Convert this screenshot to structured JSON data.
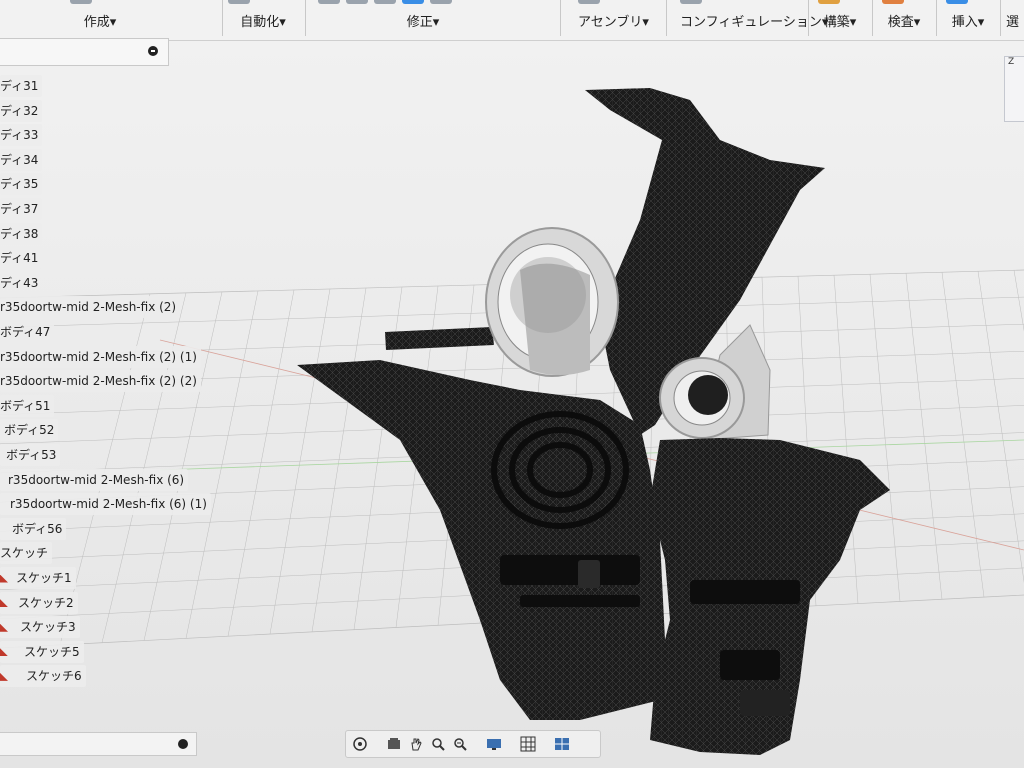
{
  "ribbon": {
    "groups": [
      {
        "id": "create",
        "label": "作成",
        "arrow": "▾"
      },
      {
        "id": "automate",
        "label": "自動化",
        "arrow": "▾"
      },
      {
        "id": "modify",
        "label": "修正",
        "arrow": "▾"
      },
      {
        "id": "assemble",
        "label": "アセンブリ",
        "arrow": "▾"
      },
      {
        "id": "configure",
        "label": "コンフィギュレーション",
        "arrow": "▾"
      },
      {
        "id": "construct",
        "label": "構築",
        "arrow": "▾"
      },
      {
        "id": "inspect",
        "label": "検査",
        "arrow": "▾"
      },
      {
        "id": "insert",
        "label": "挿入",
        "arrow": "▾"
      },
      {
        "id": "select",
        "label": "選"
      }
    ]
  },
  "browser": {
    "items": [
      {
        "label": "ディ31"
      },
      {
        "label": "ディ32"
      },
      {
        "label": "ディ33"
      },
      {
        "label": "ディ34"
      },
      {
        "label": "ディ35"
      },
      {
        "label": "ディ37"
      },
      {
        "label": "ディ38"
      },
      {
        "label": "ディ41"
      },
      {
        "label": "ディ43"
      },
      {
        "label": "r35doortw-mid 2-Mesh-fix (2)"
      },
      {
        "label": "ボディ47"
      },
      {
        "label": "r35doortw-mid 2-Mesh-fix (2) (1)"
      },
      {
        "label": "r35doortw-mid 2-Mesh-fix (2) (2)"
      },
      {
        "label": "ボディ51"
      },
      {
        "label": "ボディ52"
      },
      {
        "label": "ボディ53"
      },
      {
        "label": "r35doortw-mid 2-Mesh-fix (6)"
      },
      {
        "label": "r35doortw-mid 2-Mesh-fix (6) (1)"
      },
      {
        "label": "ボディ56"
      },
      {
        "label": "スケッチ"
      },
      {
        "label": "スケッチ1"
      },
      {
        "label": "スケッチ2"
      },
      {
        "label": "スケッチ3"
      },
      {
        "label": "スケッチ5"
      },
      {
        "label": "スケッチ6"
      }
    ]
  },
  "viewcube": {
    "label": "Z"
  },
  "colors": {
    "mesh": "#1c1c1c",
    "pipe_inner": "#d6d6d6",
    "grid": "#b8b8b8",
    "bg": "#ececec"
  }
}
